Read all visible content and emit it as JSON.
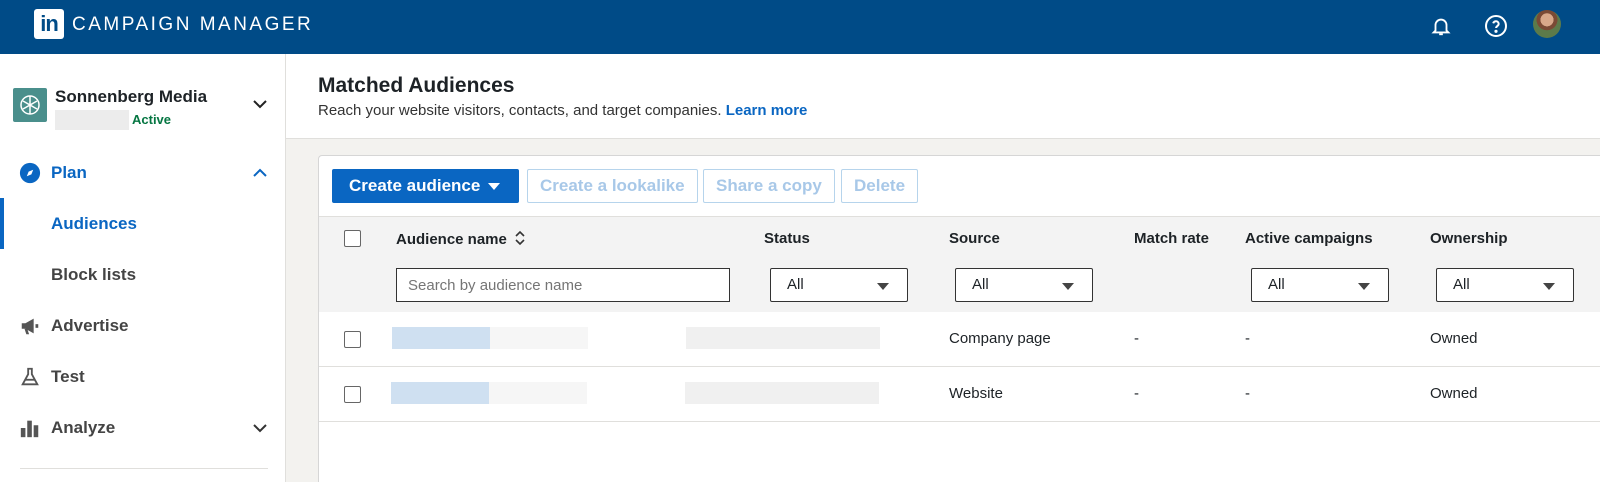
{
  "topbar": {
    "logo_text": "in",
    "app_title": "CAMPAIGN MANAGER",
    "icons": [
      "bell-icon",
      "help-icon",
      "profile-avatar"
    ],
    "background": "#004b87"
  },
  "sidebar": {
    "account": {
      "name": "Sonnenberg Media",
      "status": "Active"
    },
    "items": [
      {
        "label": "Plan",
        "icon": "compass-icon",
        "expanded": true
      },
      {
        "label": "Audiences",
        "sub": true,
        "selected": true
      },
      {
        "label": "Block lists",
        "sub": true
      },
      {
        "label": "Advertise",
        "icon": "megaphone-icon"
      },
      {
        "label": "Test",
        "icon": "flask-icon"
      },
      {
        "label": "Analyze",
        "icon": "bar-chart-icon",
        "expanded": false
      }
    ]
  },
  "main": {
    "title": "Matched Audiences",
    "subtitle": "Reach your website visitors, contacts, and target companies.",
    "learn_more": "Learn more",
    "toolbar": {
      "create": "Create audience",
      "lookalike": "Create a lookalike",
      "share": "Share a copy",
      "delete": "Delete"
    },
    "table": {
      "columns": {
        "name": "Audience name",
        "status": "Status",
        "source": "Source",
        "match_rate": "Match rate",
        "active_campaigns": "Active campaigns",
        "ownership": "Ownership"
      },
      "search_placeholder": "Search by audience name",
      "filters": {
        "status": "All",
        "source": "All",
        "active_campaigns": "All",
        "ownership": "All"
      },
      "rows": [
        {
          "source": "Company page",
          "match_rate": "-",
          "active_campaigns": "-",
          "ownership": "Owned"
        },
        {
          "source": "Website",
          "match_rate": "-",
          "active_campaigns": "-",
          "ownership": "Owned"
        }
      ]
    }
  },
  "colors": {
    "accent": "#0a66c2",
    "status_active": "#057642"
  }
}
